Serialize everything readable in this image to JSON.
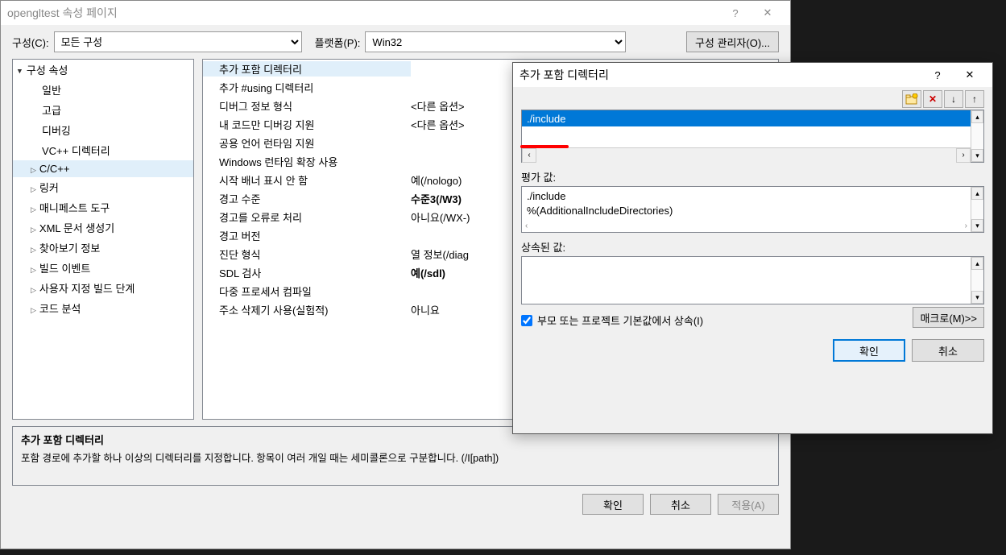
{
  "main": {
    "title": "opengltest 속성 페이지",
    "help": "?",
    "close": "✕",
    "config_label": "구성(C):",
    "config_value": "모든 구성",
    "platform_label": "플랫폼(P):",
    "platform_value": "Win32",
    "config_manager": "구성 관리자(O)...",
    "tree": {
      "root": "구성 속성",
      "items": [
        {
          "label": "일반",
          "exp": false
        },
        {
          "label": "고급",
          "exp": false
        },
        {
          "label": "디버깅",
          "exp": false
        },
        {
          "label": "VC++ 디렉터리",
          "exp": false
        },
        {
          "label": "C/C++",
          "exp": true,
          "selected": true
        },
        {
          "label": "링커",
          "exp": true
        },
        {
          "label": "매니페스트 도구",
          "exp": true
        },
        {
          "label": "XML 문서 생성기",
          "exp": true
        },
        {
          "label": "찾아보기 정보",
          "exp": true
        },
        {
          "label": "빌드 이벤트",
          "exp": true
        },
        {
          "label": "사용자 지정 빌드 단계",
          "exp": true
        },
        {
          "label": "코드 분석",
          "exp": true
        }
      ]
    },
    "props": [
      {
        "label": "추가 포함 디렉터리",
        "value": "",
        "selected": true
      },
      {
        "label": "추가 #using 디렉터리",
        "value": ""
      },
      {
        "label": "디버그 정보 형식",
        "value": "<다른 옵션>"
      },
      {
        "label": "내 코드만 디버깅 지원",
        "value": "<다른 옵션>"
      },
      {
        "label": "공용 언어 런타임 지원",
        "value": ""
      },
      {
        "label": "Windows 런타임 확장 사용",
        "value": ""
      },
      {
        "label": "시작 배너 표시 안 함",
        "value": "예(/nologo)"
      },
      {
        "label": "경고 수준",
        "value": "수준3(/W3)",
        "bold": true
      },
      {
        "label": "경고를 오류로 처리",
        "value": "아니요(/WX-)"
      },
      {
        "label": "경고 버전",
        "value": ""
      },
      {
        "label": "진단 형식",
        "value": "열 정보(/diag"
      },
      {
        "label": "SDL 검사",
        "value": "예(/sdl)",
        "bold": true
      },
      {
        "label": "다중 프로세서 컴파일",
        "value": ""
      },
      {
        "label": "주소 삭제기 사용(실험적)",
        "value": "아니요"
      }
    ],
    "desc": {
      "title": "추가 포함 디렉터리",
      "body": "포함 경로에 추가할 하나 이상의 디렉터리를 지정합니다. 항목이 여러 개일 때는 세미콜론으로 구분합니다.    (/I[path])"
    },
    "ok": "확인",
    "cancel": "취소",
    "apply": "적용(A)"
  },
  "modal": {
    "title": "추가 포함 디렉터리",
    "help": "?",
    "close": "✕",
    "path_value": "./include",
    "eval_label": "평가 값:",
    "eval_lines": [
      "./include",
      "%(AdditionalIncludeDirectories)"
    ],
    "inherit_label": "상속된 값:",
    "checkbox_label": "부모 또는 프로젝트 기본값에서 상속(I)",
    "macro": "매크로(M)>>",
    "ok": "확인",
    "cancel": "취소"
  }
}
